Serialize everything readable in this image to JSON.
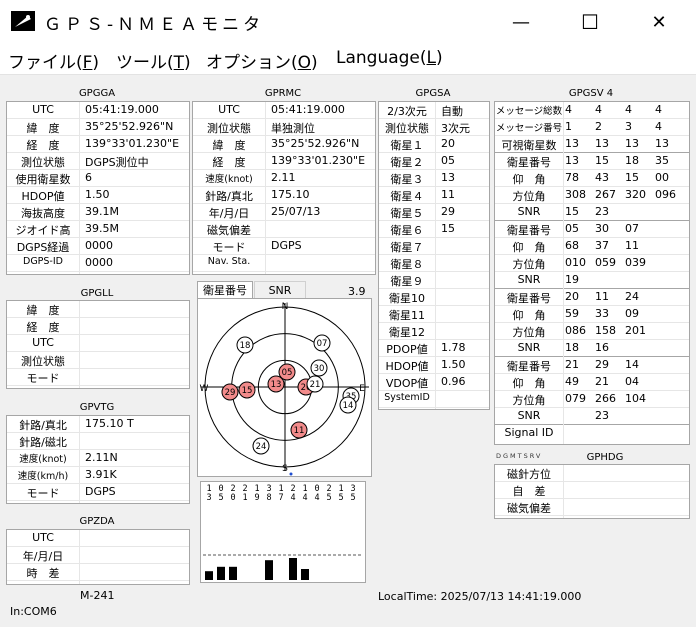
{
  "window": {
    "title": "ＧＰＳ-ＮＭＥＡモニタ",
    "minimize": "—",
    "maximize": "☐",
    "close": "✕"
  },
  "menu": [
    {
      "label": "ファイル(",
      "key": "F",
      "end": ")"
    },
    {
      "label": "ツール(",
      "key": "T",
      "end": ")"
    },
    {
      "label": "オプション(",
      "key": "O",
      "end": ")"
    },
    {
      "label": "Language(",
      "key": "L",
      "end": ")"
    }
  ],
  "gpgga": {
    "title": "GPGGA",
    "rows": [
      {
        "label": "UTC",
        "value": "05:41:19.000"
      },
      {
        "label": "緯　度",
        "value": "35°25'52.926\"N"
      },
      {
        "label": "経　度",
        "value": "139°33'01.230\"E"
      },
      {
        "label": "測位状態",
        "value": "DGPS測位中"
      },
      {
        "label": "使用衛星数",
        "value": "6"
      },
      {
        "label": "HDOP値",
        "value": "1.50"
      },
      {
        "label": "海抜高度",
        "value": "39.1M"
      },
      {
        "label": "ジオイド高",
        "value": "39.5M"
      },
      {
        "label": "DGPS経過",
        "value": "0000"
      },
      {
        "label": "DGPS-ID",
        "value": "0000"
      }
    ]
  },
  "gprmc": {
    "title": "GPRMC",
    "rows": [
      {
        "label": "UTC",
        "value": "05:41:19.000"
      },
      {
        "label": "測位状態",
        "value": "単独測位"
      },
      {
        "label": "緯　度",
        "value": "35°25'52.926\"N"
      },
      {
        "label": "経　度",
        "value": "139°33'01.230\"E"
      },
      {
        "label": "速度(knot)",
        "value": "2.11"
      },
      {
        "label": "針路/真北",
        "value": "175.10"
      },
      {
        "label": "年/月/日",
        "value": "25/07/13"
      },
      {
        "label": "磁気偏差",
        "value": ""
      },
      {
        "label": "モード",
        "value": "DGPS"
      },
      {
        "label": "Nav. Sta.",
        "value": ""
      }
    ]
  },
  "gpgsa": {
    "title": "GPGSA",
    "rows": [
      {
        "label": "2/3次元",
        "value": "自動"
      },
      {
        "label": "測位状態",
        "value": "3次元"
      },
      {
        "label": "衛星１",
        "value": "20"
      },
      {
        "label": "衛星２",
        "value": "05"
      },
      {
        "label": "衛星３",
        "value": "13"
      },
      {
        "label": "衛星４",
        "value": "11"
      },
      {
        "label": "衛星５",
        "value": "29"
      },
      {
        "label": "衛星６",
        "value": "15"
      },
      {
        "label": "衛星７",
        "value": ""
      },
      {
        "label": "衛星８",
        "value": ""
      },
      {
        "label": "衛星９",
        "value": ""
      },
      {
        "label": "衛星10",
        "value": ""
      },
      {
        "label": "衛星11",
        "value": ""
      },
      {
        "label": "衛星12",
        "value": ""
      },
      {
        "label": "PDOP値",
        "value": "1.78"
      },
      {
        "label": "HDOP値",
        "value": "1.50"
      },
      {
        "label": "VDOP値",
        "value": "0.96"
      },
      {
        "label": "SystemID",
        "value": ""
      }
    ]
  },
  "gpgsv": {
    "title": "GPGSV 4",
    "header": [
      {
        "label": "メッセージ総数",
        "values": [
          "4",
          "4",
          "4",
          "4"
        ]
      },
      {
        "label": "メッセージ番号",
        "values": [
          "1",
          "2",
          "3",
          "4"
        ]
      },
      {
        "label": "可視衛星数",
        "values": [
          "13",
          "13",
          "13",
          "13"
        ]
      }
    ],
    "blocks": [
      [
        {
          "label": "衛星番号",
          "values": [
            "13",
            "15",
            "18",
            "35"
          ]
        },
        {
          "label": "仰　角",
          "values": [
            "78",
            "43",
            "15",
            "00"
          ]
        },
        {
          "label": "方位角",
          "values": [
            "308",
            "267",
            "320",
            "096"
          ]
        },
        {
          "label": "SNR",
          "values": [
            "15",
            "23",
            "",
            ""
          ]
        }
      ],
      [
        {
          "label": "衛星番号",
          "values": [
            "05",
            "30",
            "07",
            ""
          ]
        },
        {
          "label": "仰　角",
          "values": [
            "68",
            "37",
            "11",
            ""
          ]
        },
        {
          "label": "方位角",
          "values": [
            "010",
            "059",
            "039",
            ""
          ]
        },
        {
          "label": "SNR",
          "values": [
            "19",
            "",
            "",
            ""
          ]
        }
      ],
      [
        {
          "label": "衛星番号",
          "values": [
            "20",
            "11",
            "24",
            ""
          ]
        },
        {
          "label": "仰　角",
          "values": [
            "59",
            "33",
            "09",
            ""
          ]
        },
        {
          "label": "方位角",
          "values": [
            "086",
            "158",
            "201",
            ""
          ]
        },
        {
          "label": "SNR",
          "values": [
            "18",
            "16",
            "",
            ""
          ]
        }
      ],
      [
        {
          "label": "衛星番号",
          "values": [
            "21",
            "29",
            "14",
            ""
          ]
        },
        {
          "label": "仰　角",
          "values": [
            "49",
            "21",
            "04",
            ""
          ]
        },
        {
          "label": "方位角",
          "values": [
            "079",
            "266",
            "104",
            ""
          ]
        },
        {
          "label": "SNR",
          "values": [
            "",
            "23",
            "",
            ""
          ]
        }
      ]
    ],
    "signal_id": "Signal ID"
  },
  "sky": {
    "tabs": [
      "衛星番号",
      "SNR"
    ],
    "value": "3.9",
    "directions": {
      "n": "N",
      "e": "E",
      "s": "S",
      "w": "W"
    },
    "sats": [
      {
        "id": "18",
        "used": false
      },
      {
        "id": "07",
        "used": false
      },
      {
        "id": "05",
        "used": true
      },
      {
        "id": "30",
        "used": false
      },
      {
        "id": "13",
        "used": true
      },
      {
        "id": "20",
        "used": true
      },
      {
        "id": "21",
        "used": false
      },
      {
        "id": "35",
        "used": false
      },
      {
        "id": "14",
        "used": false
      },
      {
        "id": "29",
        "used": true
      },
      {
        "id": "15",
        "used": true
      },
      {
        "id": "11",
        "used": true
      },
      {
        "id": "24",
        "used": false
      }
    ],
    "used_color": "#f28b8b"
  },
  "snr_chart": {
    "col_tens": [
      "1",
      "0",
      "2",
      "2",
      "1",
      "3",
      "1",
      "2",
      "1",
      "0",
      "2",
      "1",
      "3"
    ],
    "col_ones": [
      "3",
      "5",
      "0",
      "1",
      "9",
      "8",
      "7",
      "4",
      "4",
      "4",
      "5",
      "5",
      "5"
    ],
    "bars": [
      4,
      6,
      6,
      0,
      0,
      9,
      0,
      10,
      5,
      0,
      0,
      0,
      0
    ]
  },
  "gpgll": {
    "title": "GPGLL",
    "rows": [
      {
        "label": "緯　度",
        "value": ""
      },
      {
        "label": "経　度",
        "value": ""
      },
      {
        "label": "UTC",
        "value": ""
      },
      {
        "label": "測位状態",
        "value": ""
      },
      {
        "label": "モード",
        "value": ""
      }
    ]
  },
  "gpvtg": {
    "title": "GPVTG",
    "rows": [
      {
        "label": "針路/真北",
        "value": "175.10 T"
      },
      {
        "label": "針路/磁北",
        "value": ""
      },
      {
        "label": "速度(knot)",
        "value": "2.11N"
      },
      {
        "label": "速度(km/h)",
        "value": "3.91K"
      },
      {
        "label": "モード",
        "value": "DGPS"
      }
    ]
  },
  "gpzda": {
    "title": "GPZDA",
    "rows": [
      {
        "label": "UTC",
        "value": ""
      },
      {
        "label": "年/月/日",
        "value": ""
      },
      {
        "label": "時　差",
        "value": ""
      }
    ]
  },
  "gphdg": {
    "title": "GPHDG",
    "flags": "DGMTSRV",
    "rows": [
      {
        "label": "磁針方位",
        "value": ""
      },
      {
        "label": "自　差",
        "value": ""
      },
      {
        "label": "磁気偏差",
        "value": ""
      }
    ]
  },
  "status": {
    "model": "M-241",
    "port": "In:COM6",
    "localtime": "LocalTime: 2025/07/13 14:41:19.000"
  }
}
